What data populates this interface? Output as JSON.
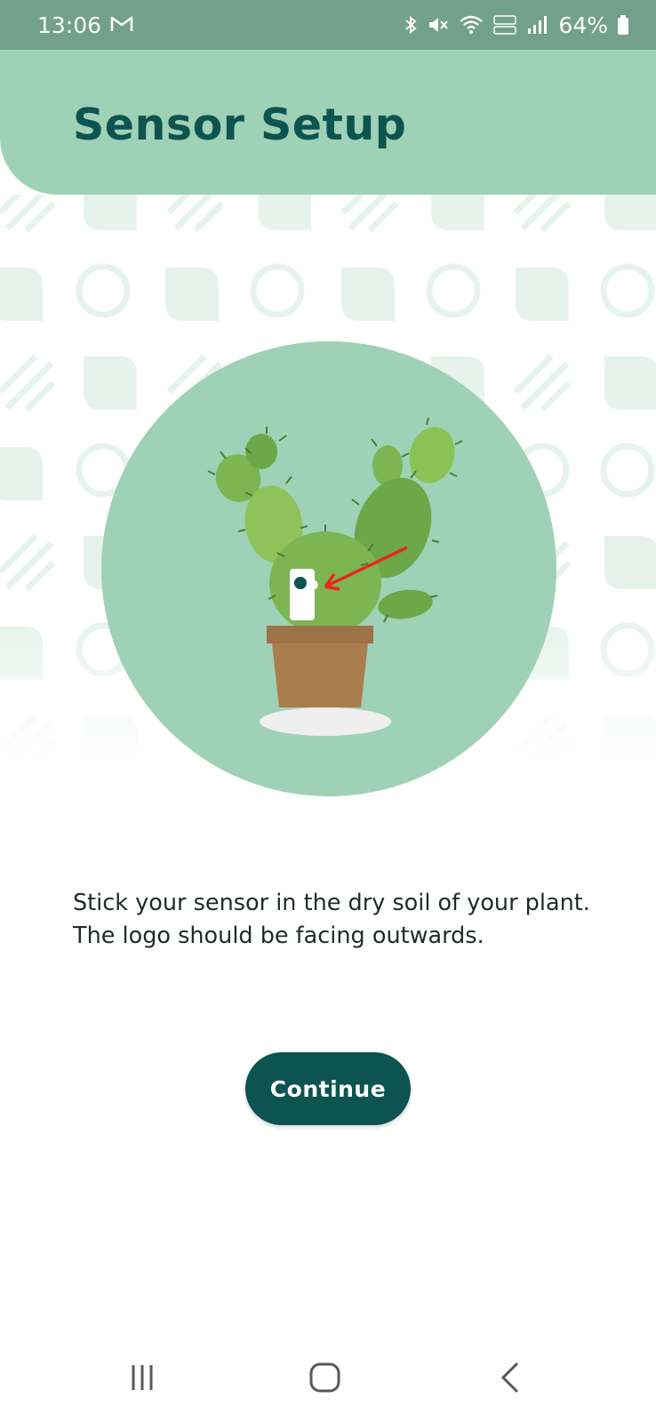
{
  "status_bar": {
    "time": "13:06",
    "battery_percent": "64%",
    "left_icons": [
      "gmail-icon"
    ],
    "right_icons": [
      "bluetooth-icon",
      "mute-icon",
      "wifi-icon",
      "volte-icon",
      "signal-icon",
      "battery-icon"
    ]
  },
  "header": {
    "title": "Sensor Setup"
  },
  "main": {
    "illustration": "cactus-with-sensor-illustration",
    "instruction": "Stick your sensor in the dry soil of your plant. The logo should be facing outwards.",
    "continue_label": "Continue"
  },
  "nav_bar": {
    "buttons": [
      "recent-apps-icon",
      "home-icon",
      "back-icon"
    ]
  },
  "colors": {
    "status_bar": "#73a08a",
    "header": "#9fd1b6",
    "title": "#0d5450",
    "button": "#0d5450",
    "hero_circle": "#9fd1b6",
    "pot": "#a97d4e",
    "cactus": "#7db553",
    "arrow": "#e5281e",
    "pattern": "#e6f3ec"
  }
}
